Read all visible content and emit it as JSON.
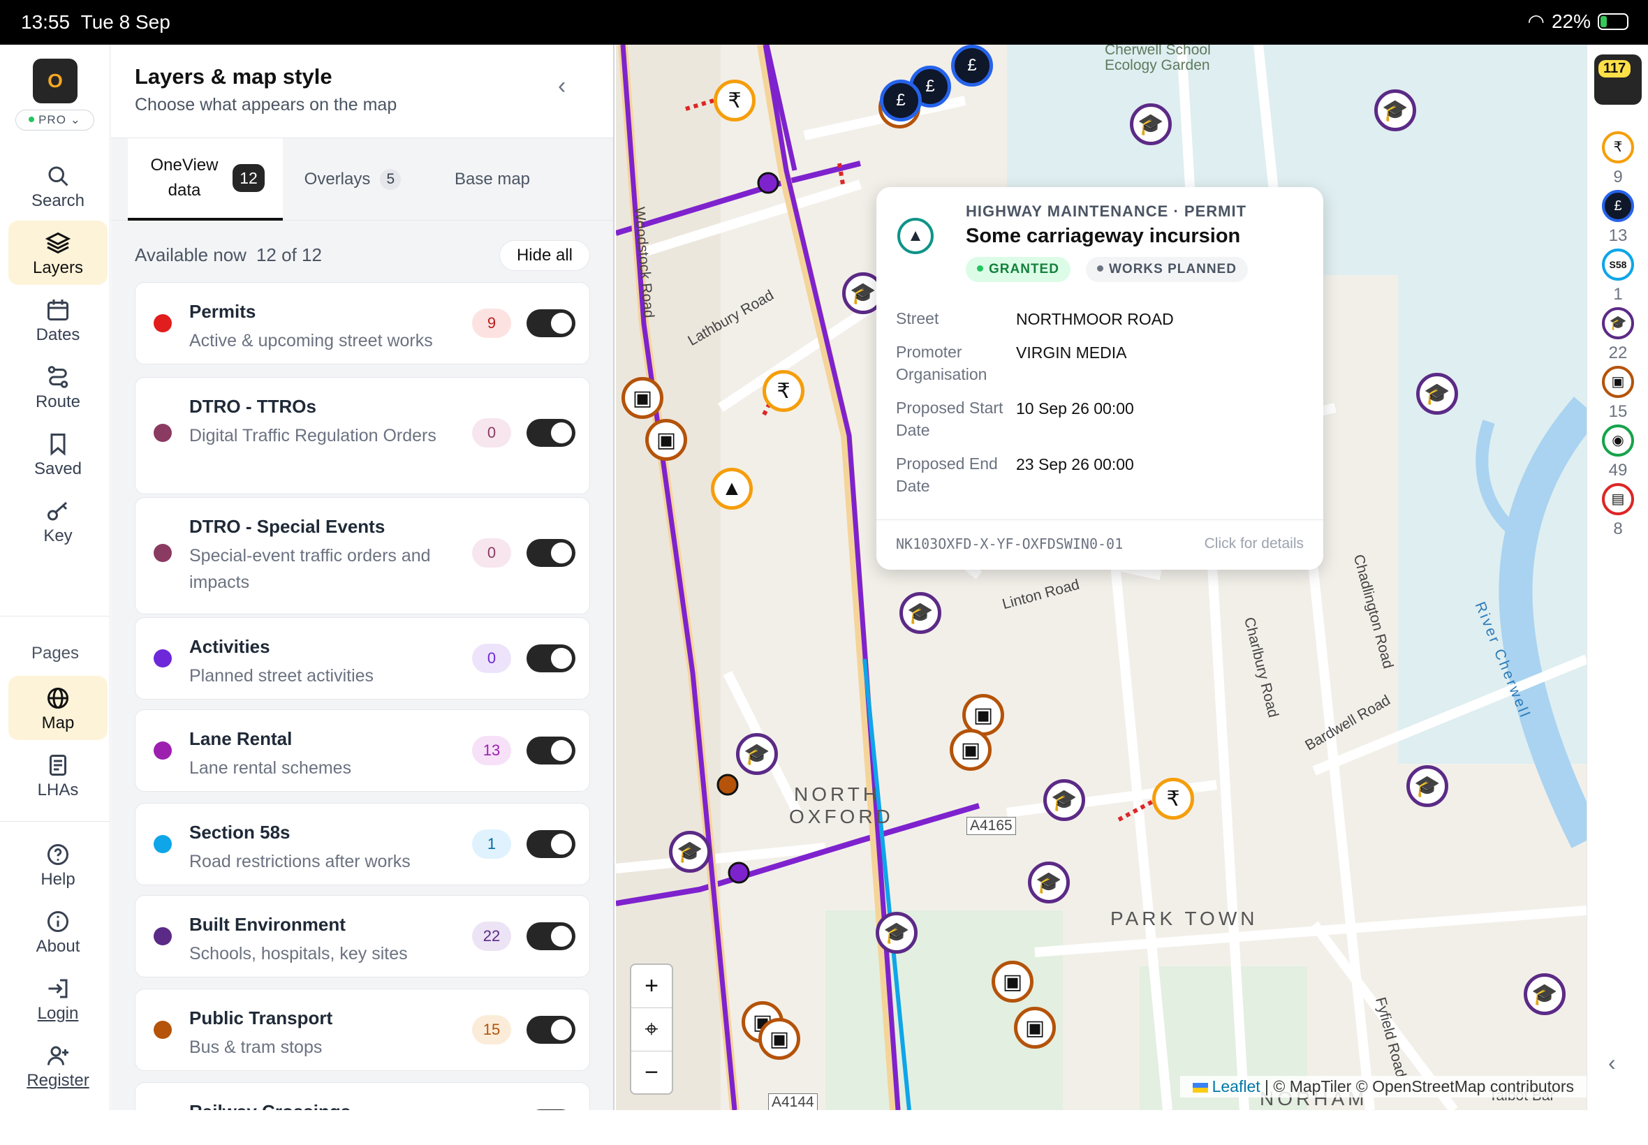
{
  "status_bar": {
    "time": "13:55",
    "date": "Tue 8 Sep",
    "battery": "22%"
  },
  "rail": {
    "logo": "O",
    "plan": "PRO",
    "items": [
      {
        "label": "Search",
        "icon": "search-icon"
      },
      {
        "label": "Layers",
        "icon": "layers-icon",
        "active": true
      },
      {
        "label": "Dates",
        "icon": "calendar-icon"
      },
      {
        "label": "Route",
        "icon": "route-icon"
      },
      {
        "label": "Saved",
        "icon": "bookmark-icon"
      },
      {
        "label": "Key",
        "icon": "key-icon"
      }
    ],
    "pages_heading": "Pages",
    "pages": [
      {
        "label": "Map",
        "icon": "globe-icon",
        "active": true
      },
      {
        "label": "LHAs",
        "icon": "document-icon"
      }
    ],
    "footer": [
      {
        "label": "Help",
        "icon": "help-icon"
      },
      {
        "label": "About",
        "icon": "info-icon"
      },
      {
        "label": "Login",
        "icon": "login-icon"
      },
      {
        "label": "Register",
        "icon": "add-user-icon"
      }
    ]
  },
  "panel": {
    "title": "Layers & map style",
    "subtitle": "Choose what appears on the map",
    "tabs": [
      {
        "label": "OneView data",
        "count": "12"
      },
      {
        "label": "Overlays",
        "count": "5"
      },
      {
        "label": "Base map",
        "count": ""
      }
    ],
    "available_label": "Available now",
    "available_count": "12 of 12",
    "hide_all": "Hide all",
    "layers": [
      {
        "name": "Permits",
        "desc": "Active & upcoming street works",
        "count": "9",
        "color": "#e11d1d",
        "enabled": true
      },
      {
        "name": "DTRO - TTROs",
        "desc": "Digital Traffic Regulation Orders",
        "count": "0",
        "color": "#8b3a62",
        "enabled": true
      },
      {
        "name": "DTRO - Special Events",
        "desc": "Special-event traffic orders and impacts",
        "count": "0",
        "color": "#8b3a62",
        "enabled": true
      },
      {
        "name": "Activities",
        "desc": "Planned street activities",
        "count": "0",
        "color": "#6d28d9",
        "enabled": true
      },
      {
        "name": "Lane Rental",
        "desc": "Lane rental schemes",
        "count": "13",
        "color": "#9d1fb0",
        "enabled": true
      },
      {
        "name": "Section 58s",
        "desc": "Road restrictions after works",
        "count": "1",
        "color": "#0ea5e9",
        "enabled": true
      },
      {
        "name": "Built Environment",
        "desc": "Schools, hospitals, key sites",
        "count": "22",
        "color": "#5b2a86",
        "enabled": true
      },
      {
        "name": "Public Transport",
        "desc": "Bus & tram stops",
        "count": "15",
        "color": "#b45309",
        "enabled": true
      },
      {
        "name": "Railway Crossings",
        "desc": "",
        "count": "",
        "color": "#dc2626",
        "enabled": true
      }
    ]
  },
  "map": {
    "labels": {
      "north_oxford_1": "NORTH",
      "north_oxford_2": "OXFORD",
      "park_town": "PARK TOWN",
      "norham": "NORHAM",
      "ecology_1": "Cherwell School",
      "ecology_2": "Ecology Garden",
      "woodstock": "Woodstock Road",
      "lathbury": "Lathbury Road",
      "linton": "Linton Road",
      "charlbury": "Charlbury Road",
      "chadlington": "Chadlington Road",
      "bardwell": "Bardwell Road",
      "cherwell": "River Cherwell",
      "fyfield": "Fyfield Road",
      "a4165": "A4165",
      "a4144": "A4144",
      "talbot": "Talbot Bar"
    },
    "zoom_in": "+",
    "zoom_out": "−",
    "attribution_leaflet": "Leaflet",
    "attribution_rest": "| © MapTiler © OpenStreetMap contributors"
  },
  "popup": {
    "category": "HIGHWAY MAINTENANCE · PERMIT",
    "title": "Some carriageway incursion",
    "status_1": "GRANTED",
    "status_2": "WORKS PLANNED",
    "fields": [
      {
        "label": "Street",
        "value": "NORTHMOOR ROAD"
      },
      {
        "label": "Promoter Organisation",
        "value": "VIRGIN MEDIA"
      },
      {
        "label": "Proposed Start Date",
        "value": "10 Sep 26 00:00"
      },
      {
        "label": "Proposed End Date",
        "value": "23 Sep 26 00:00"
      }
    ],
    "reference": "NK103OXFD-X-YF-OXFDSWIN0-01",
    "cta": "Click for details"
  },
  "right_rail": {
    "total": "117",
    "items": [
      {
        "count": "9",
        "icon": "permit-icon",
        "color": "#f59e0b"
      },
      {
        "count": "13",
        "icon": "pound-icon",
        "color": "#2563eb"
      },
      {
        "count": "1",
        "icon": "s58-icon",
        "label": "S58",
        "color": "#0ea5e9"
      },
      {
        "count": "22",
        "icon": "school-icon",
        "color": "#5b2a86"
      },
      {
        "count": "15",
        "icon": "bus-icon",
        "color": "#b45309"
      },
      {
        "count": "49",
        "icon": "pin-icon",
        "color": "#16a34a"
      },
      {
        "count": "8",
        "icon": "train-icon",
        "color": "#dc2626"
      }
    ]
  }
}
